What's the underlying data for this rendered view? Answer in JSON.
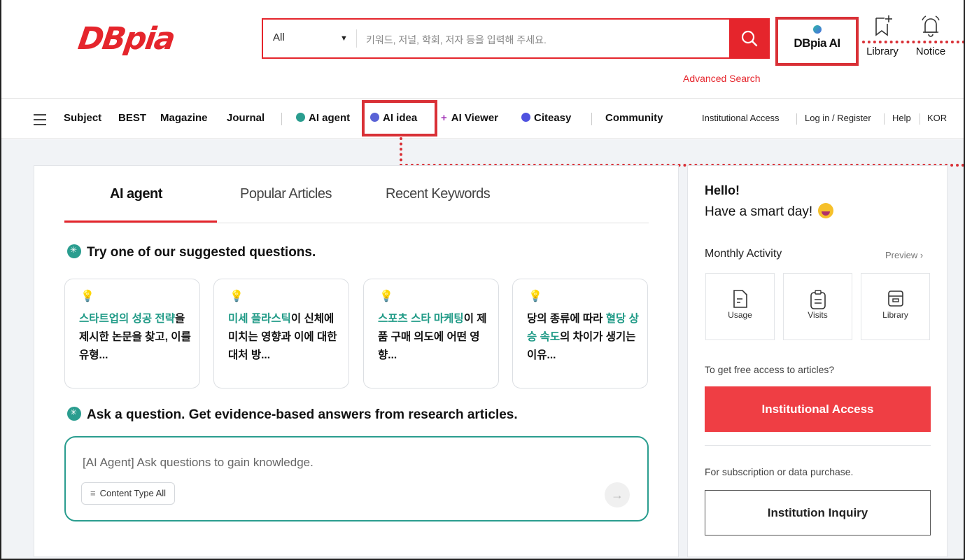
{
  "header": {
    "logo_text": "DBpia",
    "search": {
      "category": "All",
      "placeholder": "키워드, 저널, 학회, 저자 등을 입력해 주세요."
    },
    "ai_button": "DBpia AI",
    "library": "Library",
    "notice": "Notice",
    "advanced_search": "Advanced Search"
  },
  "nav": {
    "items": [
      "Subject",
      "BEST",
      "Magazine",
      "Journal"
    ],
    "ai_agent": "AI agent",
    "ai_idea": "AI idea",
    "ai_viewer": "AI Viewer",
    "citeasy": "Citeasy",
    "community": "Community",
    "right_links": [
      "Institutional Access",
      "Log in / Register",
      "Help",
      "KOR"
    ]
  },
  "main": {
    "tabs": [
      "AI agent",
      "Popular Articles",
      "Recent Keywords"
    ],
    "suggested_title": "Try one of our suggested questions.",
    "questions": [
      {
        "highlight": "스타트업의 성공 전략",
        "rest": "을 제시한 논문을 찾고, 이를 유형..."
      },
      {
        "highlight": "미세 플라스틱",
        "rest": "이 신체에 미치는 영향과 이에 대한 대처 방..."
      },
      {
        "highlight": "스포츠 스타 마케팅",
        "rest": "이 제품 구매 의도에 어떤 영향..."
      },
      {
        "prefix": "당의 종류에 따라 ",
        "highlight": "혈당 상승 속도",
        "rest": "의 차이가 생기는 이유..."
      }
    ],
    "ask_title": "Ask a question. Get evidence-based answers from research articles.",
    "ask_placeholder": "[AI Agent] Ask questions to gain knowledge.",
    "content_type": "Content Type All"
  },
  "side": {
    "hello": "Hello!",
    "smart_day": "Have a smart day!",
    "monthly_activity": "Monthly Activity",
    "preview": "Preview",
    "activities": [
      "Usage",
      "Visits",
      "Library"
    ],
    "free_access": "To get free access to articles?",
    "institutional_access": "Institutional Access",
    "subscription": "For subscription or data purchase.",
    "institution_inquiry": "Institution Inquiry"
  },
  "colors": {
    "brand_red": "#e5252c",
    "teal": "#2a9d8f",
    "highlight_red": "#d93036"
  }
}
